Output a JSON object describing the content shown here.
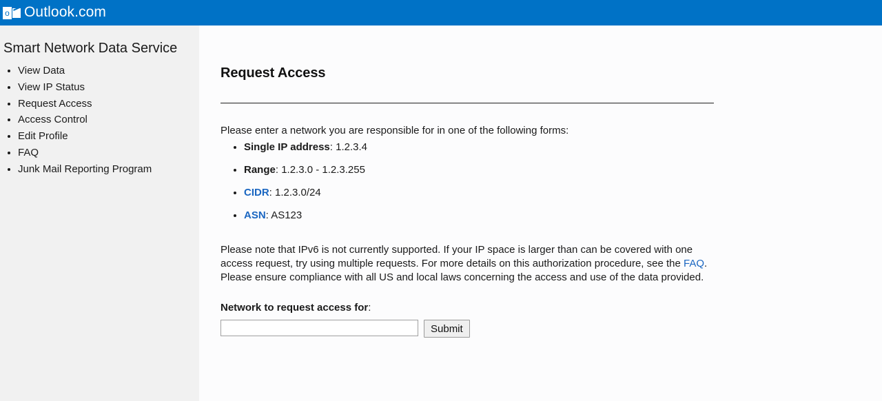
{
  "brand": {
    "logo_icon": "outlook-logo-icon",
    "logo_letter": "o",
    "name": "Outlook.com",
    "bar_color": "#0072c6"
  },
  "sidebar": {
    "title": "Smart Network Data Service",
    "items": [
      {
        "label": "View Data"
      },
      {
        "label": "View IP Status"
      },
      {
        "label": "Request Access"
      },
      {
        "label": "Access Control"
      },
      {
        "label": "Edit Profile"
      },
      {
        "label": "FAQ"
      },
      {
        "label": "Junk Mail Reporting Program"
      }
    ]
  },
  "main": {
    "heading": "Request Access",
    "intro": "Please enter a network you are responsible for in one of the following forms:",
    "forms": [
      {
        "term": "Single IP address",
        "sep": ": ",
        "value": "1.2.3.4",
        "is_link": false
      },
      {
        "term": "Range",
        "sep": ": ",
        "value": "1.2.3.0 - 1.2.3.255",
        "is_link": false
      },
      {
        "term": "CIDR",
        "sep": ": ",
        "value": "1.2.3.0/24",
        "is_link": true
      },
      {
        "term": "ASN",
        "sep": ": ",
        "value": "AS123",
        "is_link": true
      }
    ],
    "note_part1": "Please note that IPv6 is not currently supported.  If your IP space is larger than can be covered with one access request, try using multiple requests.  For more details on this authorization procedure, see the ",
    "note_link": "FAQ",
    "note_part2": ".  Please ensure compliance with all US and local laws concerning the access and use of the data provided.",
    "form": {
      "label": "Network to request access for",
      "label_colon": ":",
      "input_value": "",
      "input_placeholder": "",
      "submit_label": "Submit"
    },
    "link_color": "#1a66c1"
  }
}
